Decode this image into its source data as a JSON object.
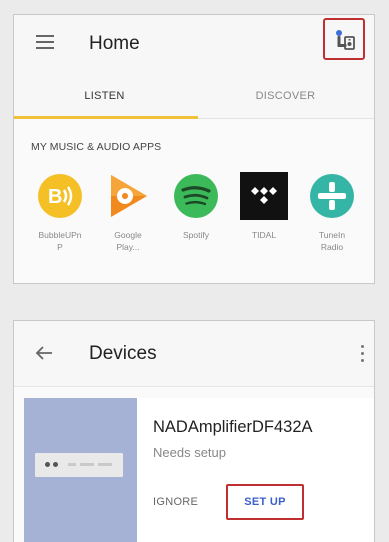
{
  "home": {
    "title": "Home",
    "tabs": [
      {
        "label": "LISTEN",
        "selected": true
      },
      {
        "label": "DISCOVER",
        "selected": false
      }
    ],
    "apps_heading": "MY MUSIC & AUDIO APPS",
    "apps": [
      {
        "label": "BubbleUPnP",
        "label_lines": [
          "BubbleUPn",
          "P"
        ],
        "icon": "bubbleupnp-icon",
        "color": "#f4c026"
      },
      {
        "label": "Google Play...",
        "label_lines": [
          "Google",
          "Play..."
        ],
        "icon": "google-play-music-icon",
        "color": "#f08a1c"
      },
      {
        "label": "Spotify",
        "label_lines": [
          "Spotify"
        ],
        "icon": "spotify-icon",
        "color": "#3cba5a"
      },
      {
        "label": "TIDAL",
        "label_lines": [
          "TIDAL"
        ],
        "icon": "tidal-icon",
        "color": "#111111"
      },
      {
        "label": "TuneIn Radio",
        "label_lines": [
          "TuneIn",
          "Radio"
        ],
        "icon": "tunein-icon",
        "color": "#35b5a5"
      }
    ]
  },
  "devices": {
    "title": "Devices",
    "device": {
      "name": "NADAmplifierDF432A",
      "status": "Needs setup",
      "ignore_label": "IGNORE",
      "setup_label": "SET UP"
    }
  },
  "colors": {
    "tab_indicator": "#f0c23c",
    "highlight_border": "#c03030",
    "setup_text": "#3b5ecc",
    "device_image_bg": "#a6b1d6"
  }
}
